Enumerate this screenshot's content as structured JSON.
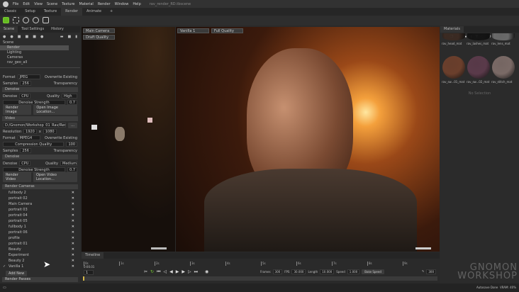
{
  "menu": [
    "File",
    "Edit",
    "View",
    "Scene",
    "Texture",
    "Material",
    "Render",
    "Window",
    "Help"
  ],
  "window_title": "rav_render_RD.tbscene",
  "workspace_tabs": [
    "Classic",
    "Setup",
    "Texture",
    "Render",
    "Animate",
    "+"
  ],
  "left": {
    "tabs": [
      "Scene",
      "Tool Settings",
      "History"
    ],
    "tree": [
      "Scene",
      "Render",
      "Lighting",
      "Cameras",
      "rav_geo_all"
    ],
    "image": {
      "format_label": "Format",
      "format": "JPEG",
      "overwrite": "Overwrite Existing",
      "samples_label": "Samples",
      "samples": "256",
      "transparency": "Transparency",
      "denoise_header": "Denoise",
      "denoise_label": "Denoise",
      "denoise": "CPU",
      "quality_label": "Quality",
      "quality": "High",
      "strength_label": "Denoise Strength",
      "strength": "0.7",
      "render_btn": "Render Image",
      "open_btn": "Open Image Location..."
    },
    "video": {
      "header": "Video",
      "path": "D:/Gnomon/Workshop_01_Rav/Render/",
      "resolution_label": "Resolution",
      "width": "1920",
      "x": "x",
      "height": "1080",
      "format_label": "Format",
      "format": "MPEG4",
      "overwrite": "Overwrite Existing",
      "compression_label": "Compression Quality",
      "compression": "100",
      "samples_label": "Samples",
      "samples": "256",
      "transparency": "Transparency",
      "denoise_header": "Denoise",
      "denoise_label": "Denoise",
      "denoise": "CPU",
      "quality_label": "Quality",
      "quality": "Medium",
      "strength_label": "Denoise Strength",
      "strength": "0.7",
      "render_btn": "Render Video",
      "open_btn": "Open Video Location..."
    },
    "cameras_header": "Render Cameras",
    "cameras": [
      "fullbody 2",
      "portrait 02",
      "Main Camera",
      "portrait 03",
      "portrait 04",
      "portrait 05",
      "fullbody 1",
      "portrait 06",
      "profile",
      "portrait 01",
      "Beauty",
      "Experiment",
      "Beauty 2",
      "Vanilla 1"
    ],
    "checked_camera": "Vanilla 1",
    "check_mark": "✓",
    "add_new": "Add New",
    "next_header": "Render Passes"
  },
  "viewport1": {
    "camera": "Main Camera",
    "quality": "Draft Quality"
  },
  "viewport2": {
    "camera": "Vanilla 1",
    "quality": "Full Quality"
  },
  "materials": {
    "title": "Materials",
    "items": [
      "rav_head_mat",
      "rav_lashes_mat",
      "rav_lens_mat",
      "rav_sw...01_mat",
      "rav_sw...02_mat",
      "rav_stitch_mat"
    ],
    "no_selection": "No Selection"
  },
  "timeline": {
    "title": "Timeline",
    "time": "0:00.01",
    "frame": "1",
    "ticks": [
      "0s",
      "1s",
      "2s",
      "3s",
      "4s",
      "5s",
      "6s",
      "7s",
      "8s",
      "9s"
    ],
    "frames_label": "Frames",
    "frames": "300",
    "fps_label": "FPS",
    "fps": "30.000",
    "length_label": "Length",
    "length": "10.000",
    "speed_label": "Speed",
    "speed": "1.000",
    "bake": "Bake Speed",
    "end": "300"
  },
  "status": {
    "autosave": "Autosave Done",
    "vram": "VRAM: 40%"
  },
  "watermark": "THE GNOMON WORKSHOP"
}
